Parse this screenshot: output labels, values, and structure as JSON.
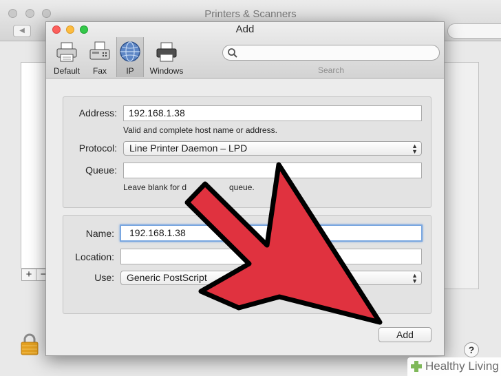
{
  "background_window": {
    "title": "Printers & Scanners",
    "back_glyph": "◀",
    "add_glyph": "+",
    "remove_glyph": "−",
    "help_glyph": "?",
    "lock_icon": "lock-icon"
  },
  "add_window": {
    "title": "Add",
    "toolbar": [
      {
        "label": "Default",
        "icon": "printer-icon"
      },
      {
        "label": "Fax",
        "icon": "fax-icon"
      },
      {
        "label": "IP",
        "icon": "globe-icon",
        "selected": true
      },
      {
        "label": "Windows",
        "icon": "windows-printer-icon"
      }
    ],
    "search": {
      "value": "",
      "label": "Search"
    },
    "address": {
      "label": "Address:",
      "value": "192.168.1.38",
      "hint": "Valid and complete host name or address."
    },
    "protocol": {
      "label": "Protocol:",
      "value": "Line Printer Daemon – LPD"
    },
    "queue": {
      "label": "Queue:",
      "value": "",
      "hint": "Leave blank for d",
      "hint_tail": "queue."
    },
    "name": {
      "label": "Name:",
      "value": "192.168.1.38"
    },
    "location": {
      "label": "Location:",
      "value": ""
    },
    "use": {
      "label": "Use:",
      "value": "Generic PostScript"
    },
    "add_button": "Add"
  },
  "overlay": {
    "arrow_color": "#e0323f",
    "arrow_outline": "#000000"
  },
  "watermark": {
    "text": "Healthy Living"
  }
}
